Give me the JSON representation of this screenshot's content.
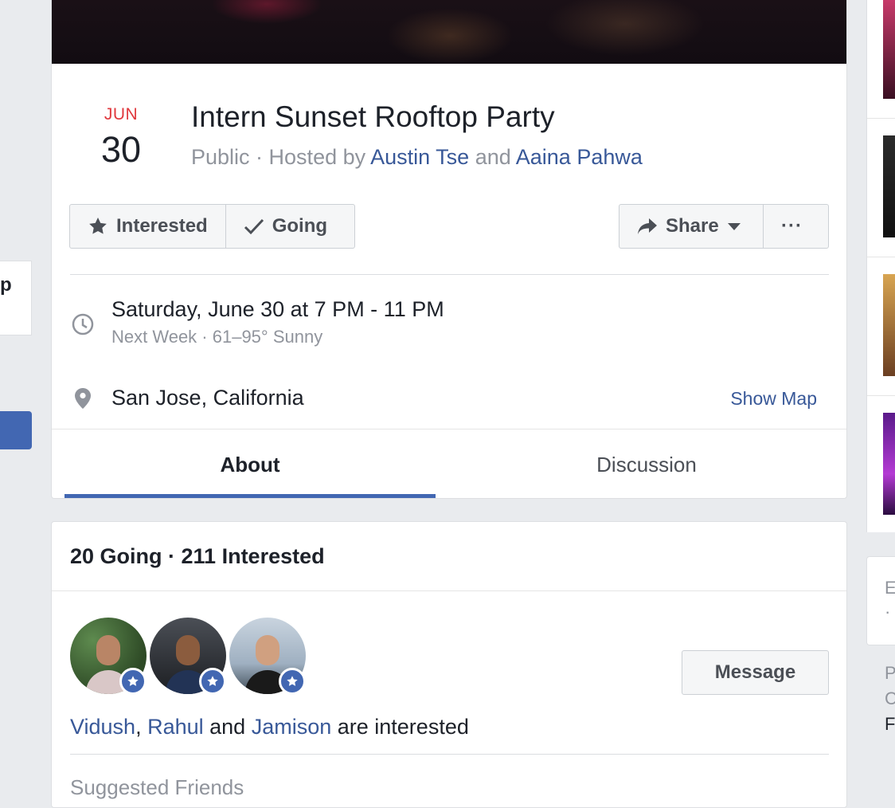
{
  "left_sidebar": {
    "card_fragment": "p"
  },
  "event": {
    "date": {
      "month": "JUN",
      "day": "30"
    },
    "title": "Intern Sunset Rooftop Party",
    "subtitle": {
      "privacy": "Public",
      "separator": " · ",
      "hosted_by": "Hosted by ",
      "host1": "Austin Tse",
      "and": " and ",
      "host2": "Aaina Pahwa"
    },
    "actions": {
      "interested_label": "Interested",
      "going_label": "Going",
      "share_label": "Share",
      "more_label": "···"
    },
    "when": {
      "main": "Saturday, June 30 at 7 PM - 11 PM",
      "secondary": "Next Week · 61–95° Sunny"
    },
    "where": {
      "main": "San Jose, California",
      "show_map": "Show Map"
    },
    "tabs": [
      {
        "label": "About",
        "active": true
      },
      {
        "label": "Discussion",
        "active": false
      }
    ]
  },
  "attendance": {
    "header": "20 Going · 211 Interested",
    "message_label": "Message",
    "friends": {
      "name1": "Vidush",
      "comma": ", ",
      "name2": "Rahul",
      "and": " and ",
      "name3": "Jamison",
      "suffix": " are interested"
    },
    "suggested_title": "Suggested Friends"
  },
  "right_column": {
    "card_fragments": [
      "E",
      "·"
    ],
    "bottom_fragments": [
      "P",
      "C",
      "F"
    ]
  },
  "colors": {
    "accent": "#4267b2",
    "link": "#385898",
    "date_month": "#e0393e",
    "muted": "#90949c"
  }
}
